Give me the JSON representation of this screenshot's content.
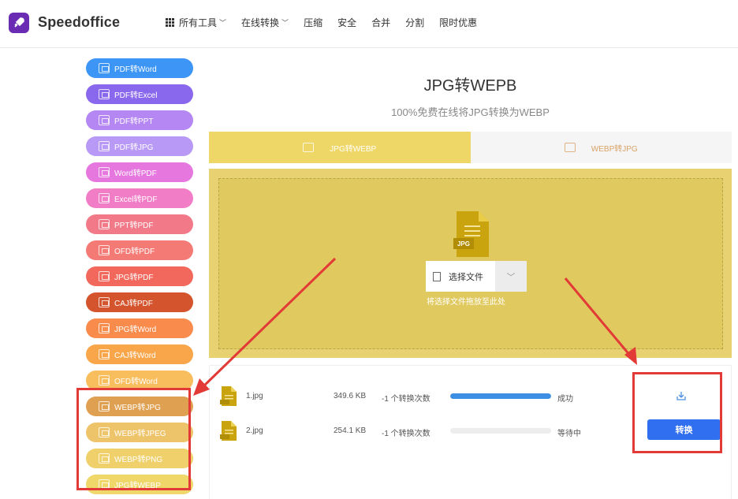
{
  "header": {
    "brand": "Speedoffice",
    "nav": [
      {
        "label": "所有工具",
        "has_dropdown": true,
        "icon": "grid-icon"
      },
      {
        "label": "在线转换",
        "has_dropdown": true
      },
      {
        "label": "压缩"
      },
      {
        "label": "安全"
      },
      {
        "label": "合并"
      },
      {
        "label": "分割"
      },
      {
        "label": "限时优惠"
      }
    ]
  },
  "sidebar": {
    "items": [
      {
        "label": "PDF转Word",
        "color": "#3d95f5"
      },
      {
        "label": "PDF转Excel",
        "color": "#8a68ee"
      },
      {
        "label": "PDF转PPT",
        "color": "#b487f3"
      },
      {
        "label": "PDF转JPG",
        "color": "#b899f5"
      },
      {
        "label": "Word转PDF",
        "color": "#e577de"
      },
      {
        "label": "Excel转PDF",
        "color": "#f27dc7"
      },
      {
        "label": "PPT转PDF",
        "color": "#f27a88"
      },
      {
        "label": "OFD转PDF",
        "color": "#f47a75"
      },
      {
        "label": "JPG转PDF",
        "color": "#f3685c"
      },
      {
        "label": "CAJ转PDF",
        "color": "#d4552d"
      },
      {
        "label": "JPG转Word",
        "color": "#f98c4c"
      },
      {
        "label": "CAJ转Word",
        "color": "#f9a54a"
      },
      {
        "label": "OFD转Word",
        "color": "#f8be5e"
      },
      {
        "label": "WEBP转JPG",
        "color": "#e0a051"
      },
      {
        "label": "WEBP转JPEG",
        "color": "#eec46a"
      },
      {
        "label": "WEBP转PNG",
        "color": "#efd06b"
      },
      {
        "label": "JPG转WEBP",
        "color": "#efd76a"
      }
    ]
  },
  "main": {
    "title": "JPG转WEPB",
    "subtitle": "100%免费在线将JPG转换为WEBP",
    "tabs": [
      {
        "label": "JPG转WEBP",
        "active": true
      },
      {
        "label": "WEBP转JPG",
        "active": false
      }
    ],
    "dropzone": {
      "file_icon_label": "JPG",
      "select_label": "选择文件",
      "hint": "将选择文件拖放至此处"
    },
    "files": [
      {
        "name": "1.jpg",
        "size": "349.6 KB",
        "count": "-1 个转换次数",
        "progress": 1.0,
        "status": "成功",
        "action": "download-icon"
      },
      {
        "name": "2.jpg",
        "size": "254.1 KB",
        "count": "-1 个转换次数",
        "progress": 0.0,
        "status": "等待中",
        "action_label": "转换"
      }
    ]
  },
  "colors": {
    "accent_yellow": "#eed767",
    "progress_blue": "#3d8fe3",
    "button_blue": "#2f6ff0",
    "annotation_red": "#e23a37"
  }
}
